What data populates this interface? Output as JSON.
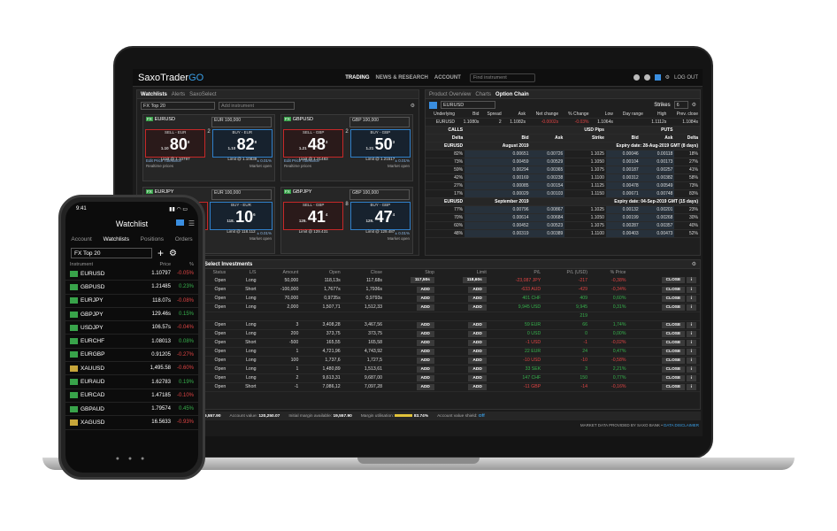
{
  "app": {
    "logo_main": "SaxoTrader",
    "logo_accent": "GO",
    "nav": [
      "TRADING",
      "NEWS & RESEARCH",
      "ACCOUNT"
    ],
    "find_placeholder": "Find instrument",
    "logout": "LOG OUT"
  },
  "watchlist_panel": {
    "tabs": [
      "Watchlists",
      "Alerts",
      "SaxoSelect"
    ],
    "list_name": "FX Top 20",
    "add_placeholder": "Add instrument",
    "tiles": [
      {
        "symbol": "EURUSD",
        "ccy": "EUR",
        "amount": "100,000",
        "sell_label": "SELL - EUR",
        "sell_prefix": "1.10",
        "sell_big": "80",
        "sell_sup": "8",
        "sell_limit": "Limit @ 1.10797",
        "spread": "2",
        "buy_label": "BUY - EUR",
        "buy_prefix": "1.10",
        "buy_big": "82",
        "buy_sup": "8",
        "buy_limit": "Limit @ 1.10839",
        "tolerance_label": "Edit Price Tolerance",
        "tolerance": "± 0.01%",
        "realtime": "Realtime prices",
        "market": "Market open"
      },
      {
        "symbol": "GBPUSD",
        "ccy": "GBP",
        "amount": "100,000",
        "sell_label": "SELL - GBP",
        "sell_prefix": "1.21",
        "sell_big": "48",
        "sell_sup": "3",
        "sell_limit": "Limit @ 1.21483",
        "spread": "2",
        "buy_label": "BUY - GBP",
        "buy_prefix": "1.21",
        "buy_big": "50",
        "buy_sup": "3",
        "buy_limit": "Limit @ 1.21517",
        "tolerance_label": "Edit Price Tolerance",
        "tolerance": "± 0.01%",
        "realtime": "Realtime prices",
        "market": "Market open"
      },
      {
        "symbol": "EURJPY",
        "ccy": "EUR",
        "amount": "100,000",
        "sell_label": "SELL - EUR",
        "sell_prefix": "118.",
        "sell_big": "10",
        "sell_sup": "6",
        "sell_limit": "Limit @ 118.112",
        "spread": "",
        "buy_label": "BUY - EUR",
        "buy_prefix": "118.",
        "buy_big": "10",
        "buy_sup": "6",
        "buy_limit": "Limit @ 118.112",
        "tolerance_label": "",
        "tolerance": "± 0.01%",
        "realtime": "",
        "market": "Market open"
      },
      {
        "symbol": "GBPJPY",
        "ccy": "GBP",
        "amount": "100,000",
        "sell_label": "SELL - GBP",
        "sell_prefix": "129.",
        "sell_big": "41",
        "sell_sup": "4",
        "sell_limit": "Limit @ 129.431",
        "spread": "8",
        "buy_label": "BUY - GBP",
        "buy_prefix": "129.",
        "buy_big": "47",
        "buy_sup": "4",
        "buy_limit": "Limit @ 129.487",
        "tolerance_label": "",
        "tolerance": "± 0.01%",
        "realtime": "",
        "market": "Market open"
      }
    ]
  },
  "option_panel": {
    "tabs": [
      "Product Overview",
      "Charts",
      "Option Chain"
    ],
    "symbol": "EURUSD",
    "strikes_label": "Strikes",
    "strikes_value": "6",
    "header_labels": [
      "Underlying",
      "Bid",
      "Spread",
      "Ask",
      "Net change",
      "% Change",
      "Low",
      "Day range",
      "High",
      "Prev. close"
    ],
    "header_values": [
      "EURUSD",
      "1.1080s",
      "2",
      "1.1082s",
      "-0.0002s",
      "-0.03%",
      "1.1064s",
      "",
      "1.1112s",
      "1.1084s"
    ],
    "calls": "CALLS",
    "puts": "PUTS",
    "pips": "USD Pips",
    "cols": [
      "Delta",
      "Bid",
      "Ask",
      "Strike",
      "Bid",
      "Ask",
      "Delta"
    ],
    "groups": [
      {
        "name": "EURUSD",
        "month": "August 2019",
        "expiry": "Expiry date: 28-Aug-2019 GMT (8 days)",
        "rows": [
          [
            "82%",
            "0.00651",
            "0.00726",
            "1.1025",
            "0.00046",
            "0.00118",
            "18%"
          ],
          [
            "73%",
            "0.00459",
            "0.00529",
            "1.1050",
            "0.00104",
            "0.00173",
            "27%"
          ],
          [
            "59%",
            "0.00294",
            "0.00365",
            "1.1075",
            "0.00187",
            "0.00257",
            "41%"
          ],
          [
            "42%",
            "0.00169",
            "0.00238",
            "1.1100",
            "0.00312",
            "0.00382",
            "58%"
          ],
          [
            "27%",
            "0.00085",
            "0.00154",
            "1.1125",
            "0.00478",
            "0.00549",
            "73%"
          ],
          [
            "17%",
            "0.00029",
            "0.00103",
            "1.1150",
            "0.00671",
            "0.00748",
            "83%"
          ]
        ]
      },
      {
        "name": "EURUSD",
        "month": "September 2019",
        "expiry": "Expiry date: 04-Sep-2019 GMT (15 days)",
        "rows": [
          [
            "77%",
            "0.00796",
            "0.00867",
            "1.1025",
            "0.00132",
            "0.00201",
            "23%"
          ],
          [
            "70%",
            "0.00614",
            "0.00684",
            "1.1050",
            "0.00199",
            "0.00268",
            "30%"
          ],
          [
            "60%",
            "0.00452",
            "0.00523",
            "1.1075",
            "0.00287",
            "0.00357",
            "40%"
          ],
          [
            "48%",
            "0.00319",
            "0.00389",
            "1.1100",
            "0.00403",
            "0.00473",
            "52%"
          ]
        ]
      }
    ]
  },
  "positions": {
    "title": "Select Investments",
    "cols": [
      "#",
      "Status",
      "L/S",
      "Amount",
      "Open",
      "Close",
      "Stop",
      "Limit",
      "P/L",
      "P/L (USD)",
      "% Price"
    ],
    "group1_total": "6 709",
    "group2_total": "219",
    "rows": [
      [
        "",
        "",
        "Open",
        "Long",
        "50,000",
        "118,13s",
        "117,68s",
        "117,50s",
        "118,60s",
        "-23,087 JPY",
        "-217",
        "-0,38%"
      ],
      [
        "",
        "",
        "Open",
        "Short",
        "-100,000",
        "1,7677s",
        "1,7936s",
        "ADD",
        "ADD",
        "-633 AUD",
        "-429",
        "-0,34%"
      ],
      [
        "",
        "",
        "Open",
        "Long",
        "70,000",
        "0,9735s",
        "0,9793s",
        "ADD",
        "ADD",
        "401 CHF",
        "409",
        "0,60%"
      ],
      [
        "",
        "2",
        "Open",
        "Long",
        "2,000",
        "1,507,71",
        "1,512,33",
        "ADD",
        "ADD",
        "9,945 USD",
        "9,945",
        "0,31%"
      ],
      [
        "",
        "",
        "Open",
        "Long",
        "3",
        "3,408,28",
        "3,467,56",
        "ADD",
        "ADD",
        "59 EUR",
        "66",
        "1,74%"
      ],
      [
        "9",
        "",
        "Open",
        "Long",
        "200",
        "373,75",
        "373,75",
        "ADD",
        "ADD",
        "0 USD",
        "0",
        "0,00%"
      ],
      [
        "ber 2019",
        "",
        "Open",
        "Short",
        "-500",
        "165,55",
        "165,58",
        "ADD",
        "ADD",
        "-1 USD",
        "-1",
        "-0,02%"
      ],
      [
        "",
        "",
        "Open",
        "Long",
        "1",
        "4,721,96",
        "4,743,92",
        "ADD",
        "ADD",
        "22 EUR",
        "24",
        "0,47%"
      ],
      [
        "9",
        "",
        "Open",
        "Long",
        "100",
        "1,737,6",
        "1,727,5",
        "ADD",
        "ADD",
        "-10 USD",
        "-10",
        "-0,58%"
      ],
      [
        "",
        "",
        "Open",
        "Long",
        "1",
        "1,480,89",
        "1,513,61",
        "ADD",
        "ADD",
        "33 SEK",
        "3",
        "2,21%"
      ],
      [
        "",
        "",
        "Open",
        "Long",
        "2",
        "9,613,31",
        "9,687,00",
        "ADD",
        "ADD",
        "147 CHF",
        "150",
        "0,77%"
      ],
      [
        "",
        "",
        "Open",
        "Short",
        "-1",
        "7,086,12",
        "7,097,28",
        "ADD",
        "ADD",
        "-11 GBP",
        "-14",
        "-0,16%"
      ]
    ],
    "close_label": "CLOSE",
    "status": {
      "cash_label": "Cash available:",
      "cash": "19,557.90",
      "account_label": "Account value:",
      "account": "120,250.07",
      "margin_label": "Initial margin available:",
      "margin": "19,557.90",
      "util_label": "Margin utilisation:",
      "util": "83.74%",
      "shield_label": "Account value shield:",
      "shield": "Off"
    },
    "footer_note": "MARKET DATA PROVIDED BY SAXO BANK •",
    "footer_link": "DATA DISCLAIMER"
  },
  "phone": {
    "time": "9:41",
    "title": "Watchlist",
    "tabs": [
      "Account",
      "Watchlists",
      "Positions",
      "Orders"
    ],
    "list_name": "FX Top 20",
    "col_instrument": "Instrument",
    "col_price": "Price",
    "col_pct": "%",
    "rows": [
      {
        "sym": "EURUSD",
        "price": "1.10797",
        "pct": "-0.05%",
        "neg": true,
        "gold": false
      },
      {
        "sym": "GBPUSD",
        "price": "1.21485",
        "pct": "0.23%",
        "neg": false,
        "gold": false
      },
      {
        "sym": "EURJPY",
        "price": "118.07s",
        "pct": "-0.08%",
        "neg": true,
        "gold": false
      },
      {
        "sym": "GBPJPY",
        "price": "129.46s",
        "pct": "0.15%",
        "neg": false,
        "gold": false
      },
      {
        "sym": "USDJPY",
        "price": "106.57s",
        "pct": "-0.04%",
        "neg": true,
        "gold": false
      },
      {
        "sym": "EURCHF",
        "price": "1.08013",
        "pct": "0.08%",
        "neg": false,
        "gold": false
      },
      {
        "sym": "EURGBP",
        "price": "0.91205",
        "pct": "-0.27%",
        "neg": true,
        "gold": false
      },
      {
        "sym": "XAUUSD",
        "price": "1,495.58",
        "pct": "-0.60%",
        "neg": true,
        "gold": true
      },
      {
        "sym": "EURAUD",
        "price": "1.62783",
        "pct": "0.19%",
        "neg": false,
        "gold": false
      },
      {
        "sym": "EURCAD",
        "price": "1.47185",
        "pct": "-0.10%",
        "neg": true,
        "gold": false
      },
      {
        "sym": "GBPAUD",
        "price": "1.79574",
        "pct": "0.45%",
        "neg": false,
        "gold": false
      },
      {
        "sym": "XAGUSD",
        "price": "16.5633",
        "pct": "-0.93%",
        "neg": true,
        "gold": true
      }
    ]
  },
  "colors": {
    "accent": "#3aa0e8",
    "sell": "#c62828",
    "buy": "#2f7fc9",
    "positive": "#37b24d",
    "negative": "#e04444"
  }
}
